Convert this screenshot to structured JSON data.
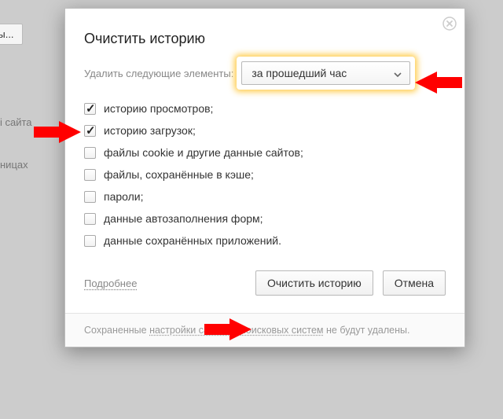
{
  "background": {
    "button_label": "фты...",
    "text1": "і сайта",
    "text2": "ницах"
  },
  "dialog": {
    "title": "Очистить историю",
    "lead_label": "Удалить следующие элементы:",
    "range_selected": "за прошедший час",
    "items": [
      {
        "label": "историю просмотров;",
        "checked": true
      },
      {
        "label": "историю загрузок;",
        "checked": true
      },
      {
        "label": "файлы cookie и другие данные сайтов;",
        "checked": false
      },
      {
        "label": "файлы, сохранённые в кэше;",
        "checked": false
      },
      {
        "label": "пароли;",
        "checked": false
      },
      {
        "label": "данные автозаполнения форм;",
        "checked": false
      },
      {
        "label": "данные сохранённых приложений.",
        "checked": false
      }
    ],
    "more_link": "Подробнее",
    "clear_button": "Очистить историю",
    "cancel_button": "Отмена",
    "footer": {
      "pre": "Сохраненные ",
      "link1": "настройки сайтов",
      "mid": " и ",
      "link2": "поисковых систем",
      "post": " не будут удалены."
    }
  }
}
